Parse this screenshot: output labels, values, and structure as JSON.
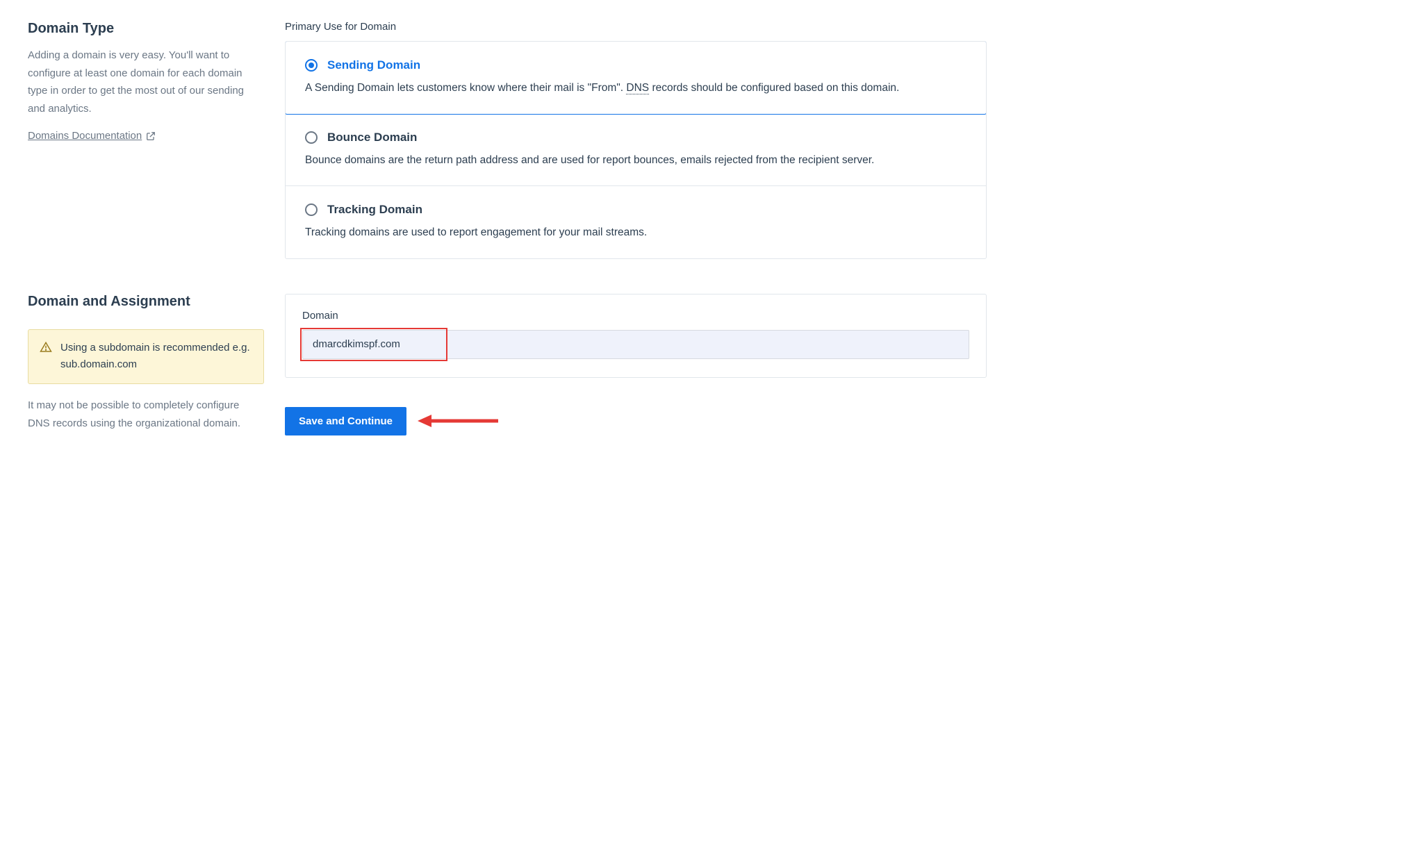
{
  "domainType": {
    "heading": "Domain Type",
    "help": "Adding a domain is very easy. You'll want to configure at least one domain for each domain type in order to get the most out of our sending and analytics.",
    "docLink": "Domains Documentation"
  },
  "primaryUse": {
    "label": "Primary Use for Domain",
    "options": [
      {
        "title": "Sending Domain",
        "desc_pre": "A Sending Domain lets customers know where their mail is \"From\". ",
        "desc_abbr": "DNS",
        "desc_post": " records should be configured based on this domain.",
        "selected": true
      },
      {
        "title": "Bounce Domain",
        "desc": "Bounce domains are the return path address and are used for report bounces, emails rejected from the recipient server.",
        "selected": false
      },
      {
        "title": "Tracking Domain",
        "desc": "Tracking domains are used to report engagement for your mail streams.",
        "selected": false
      }
    ]
  },
  "assignment": {
    "heading": "Domain and Assignment",
    "warning": "Using a subdomain is recommended e.g. sub.domain.com",
    "note": "It may not be possible to completely configure DNS records using the organizational domain.",
    "fieldLabel": "Domain",
    "fieldValue": "dmarcdkimspf.com"
  },
  "actions": {
    "save": "Save and Continue"
  },
  "colors": {
    "accent": "#1273e6",
    "highlight": "#e53935",
    "warnBg": "#fdf6d8"
  }
}
